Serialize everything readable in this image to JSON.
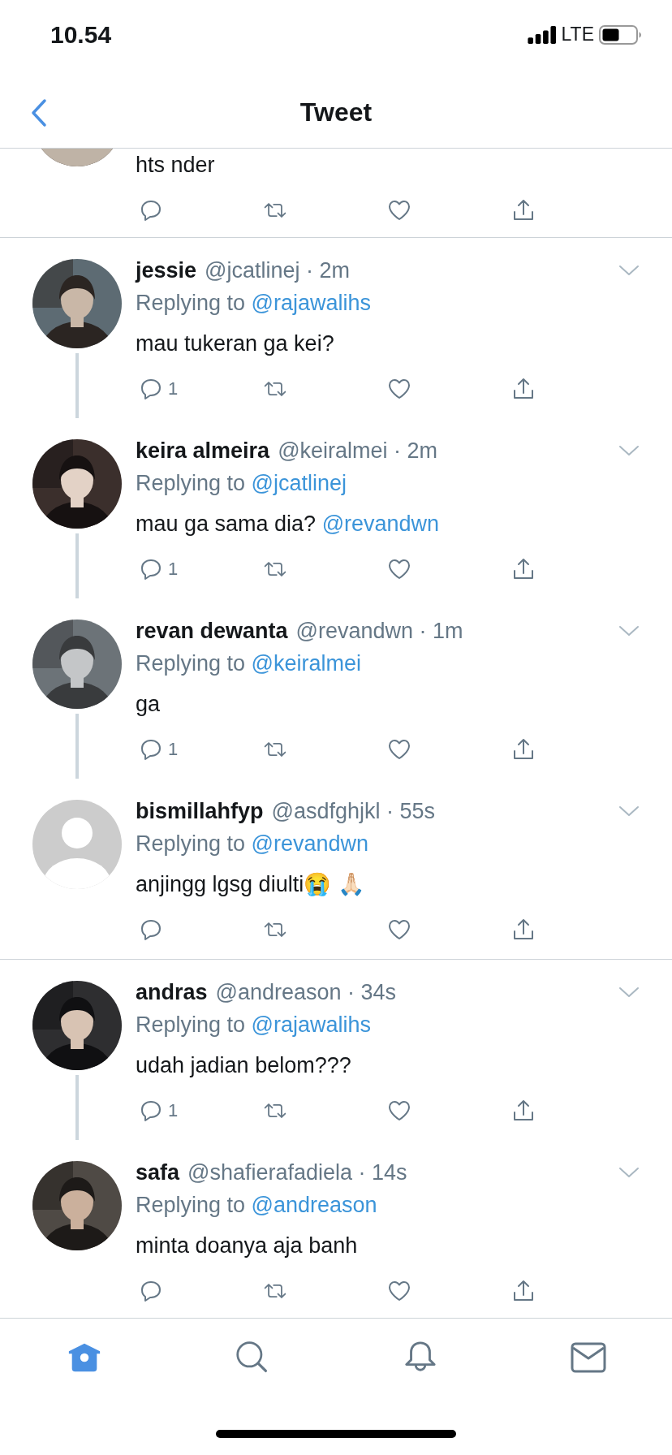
{
  "status_bar": {
    "time": "10.54",
    "network": "LTE"
  },
  "header": {
    "title": "Tweet"
  },
  "partial_tweet": {
    "text": "hts nder"
  },
  "groups": [
    {
      "tweets": [
        {
          "name": "jessie",
          "handle_time": "@jcatlinej · 2m",
          "replying_prefix": "Replying to",
          "reply_to": "@rajawalihs",
          "text": "mau tukeran ga kei?",
          "replies": "1"
        },
        {
          "name": "keira almeira",
          "handle_time": "@keiralmei · 2m",
          "replying_prefix": "Replying to",
          "reply_to": "@jcatlinej",
          "text": "mau ga sama dia? ",
          "mention": "@revandwn",
          "replies": "1"
        },
        {
          "name": "revan dewanta",
          "handle_time": "@revandwn · 1m",
          "replying_prefix": "Replying to",
          "reply_to": "@keiralmei",
          "text": "ga",
          "replies": "1"
        },
        {
          "avatar": {
            "kind": "default"
          },
          "name": "bismillahfyp",
          "handle_time": "@asdfghjkl · 55s",
          "replying_prefix": "Replying to",
          "reply_to": "@revandwn",
          "text": "anjingg lgsg diulti😭 🙏🏻"
        }
      ]
    },
    {
      "tweets": [
        {
          "name": "andras",
          "handle_time": "@andreason · 34s",
          "replying_prefix": "Replying to",
          "reply_to": "@rajawalihs",
          "text": "udah jadian belom???",
          "replies": "1"
        },
        {
          "name": "safa",
          "handle_time": "@shafierafadiela · 14s",
          "replying_prefix": "Replying to",
          "reply_to": "@andreason",
          "text": "minta doanya aja banh"
        }
      ]
    }
  ],
  "tab_bar": [
    {
      "kind": "home",
      "selected": true
    },
    {
      "kind": "search",
      "selected": false
    },
    {
      "kind": "notifications",
      "selected": false
    },
    {
      "kind": "messages",
      "selected": false
    }
  ]
}
